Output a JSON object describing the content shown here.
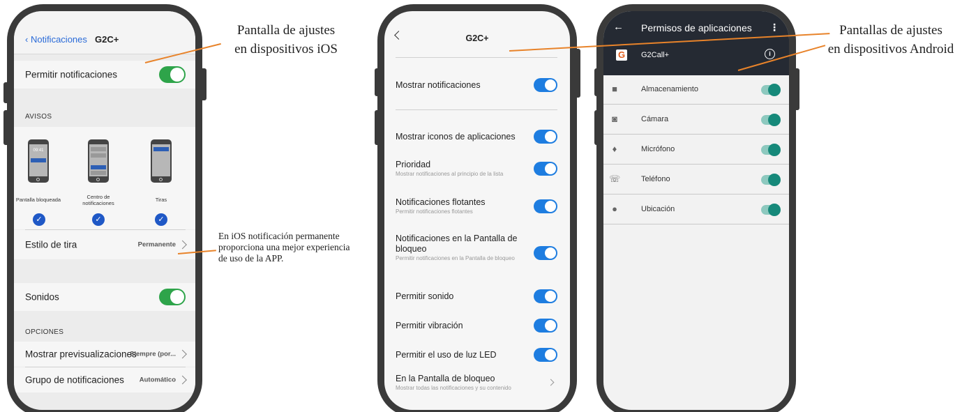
{
  "colors": {
    "phone_frame": "#3a3a3a",
    "ios_blue": "#2a6bd8",
    "ios_green": "#2ea44a",
    "android_blue": "#1e7de0",
    "teal": "#16897a",
    "header_dark": "#252a33",
    "lead_orange": "#e8832a"
  },
  "callouts": {
    "ios_line1": "Pantalla de ajustes",
    "ios_line2": "en dispositivos iOS",
    "android_line1": "Pantallas de ajustes",
    "android_line2": "en dispositivos Android",
    "note_line1": "En iOS notificación permanente",
    "note_line2": "proporciona una mejor experiencia",
    "note_line3": "de uso de la APP."
  },
  "ios": {
    "back_label": "Notificaciones",
    "title": "G2C+",
    "allow_notifications": "Permitir notificaciones",
    "section_alerts": "AVISOS",
    "mini_time": "09:41",
    "styles": [
      "Pantalla bloqueada",
      "Centro de notificaciones",
      "Tiras"
    ],
    "check_glyph": "✓",
    "banner_style_label": "Estilo de tira",
    "banner_style_value": "Permanente",
    "sounds": "Sonidos",
    "section_options": "OPCIONES",
    "show_previews_label": "Mostrar previsualizaciones",
    "show_previews_value": "Siempre (por...",
    "grouping_label": "Grupo de notificaciones",
    "grouping_value": "Automático"
  },
  "android": {
    "title": "G2C+",
    "rows": [
      {
        "label": "Mostrar notificaciones",
        "sub": ""
      },
      {
        "label": "Mostrar iconos de aplicaciones",
        "sub": ""
      },
      {
        "label": "Prioridad",
        "sub": "Mostrar notificaciones al principio de la lista"
      },
      {
        "label": "Notificaciones flotantes",
        "sub": "Permitir notificaciones flotantes"
      },
      {
        "label": "Notificaciones en la Pantalla de bloqueo",
        "sub": "Permitir notificaciones en la Pantalla de bloqueo"
      },
      {
        "label": "Permitir sonido",
        "sub": ""
      },
      {
        "label": "Permitir vibración",
        "sub": ""
      },
      {
        "label": "Permitir el uso de luz LED",
        "sub": ""
      },
      {
        "label": "En la Pantalla de bloqueo",
        "sub": "Mostrar todas las notificaciones y su contenido"
      }
    ]
  },
  "permissions": {
    "back_glyph": "←",
    "title": "Permisos de aplicaciones",
    "menu_glyph": "⋮",
    "logo_glyph": "G",
    "app_name": "G2Call+",
    "info_glyph": "i",
    "rows": [
      {
        "label": "Almacenamiento",
        "icon": "folder-icon",
        "glyph": "■"
      },
      {
        "label": "Cámara",
        "icon": "camera-icon",
        "glyph": "◙"
      },
      {
        "label": "Micrófono",
        "icon": "microphone-icon",
        "glyph": "♦"
      },
      {
        "label": "Teléfono",
        "icon": "phone-icon",
        "glyph": "☏"
      },
      {
        "label": "Ubicación",
        "icon": "location-pin-icon",
        "glyph": "●"
      }
    ]
  }
}
